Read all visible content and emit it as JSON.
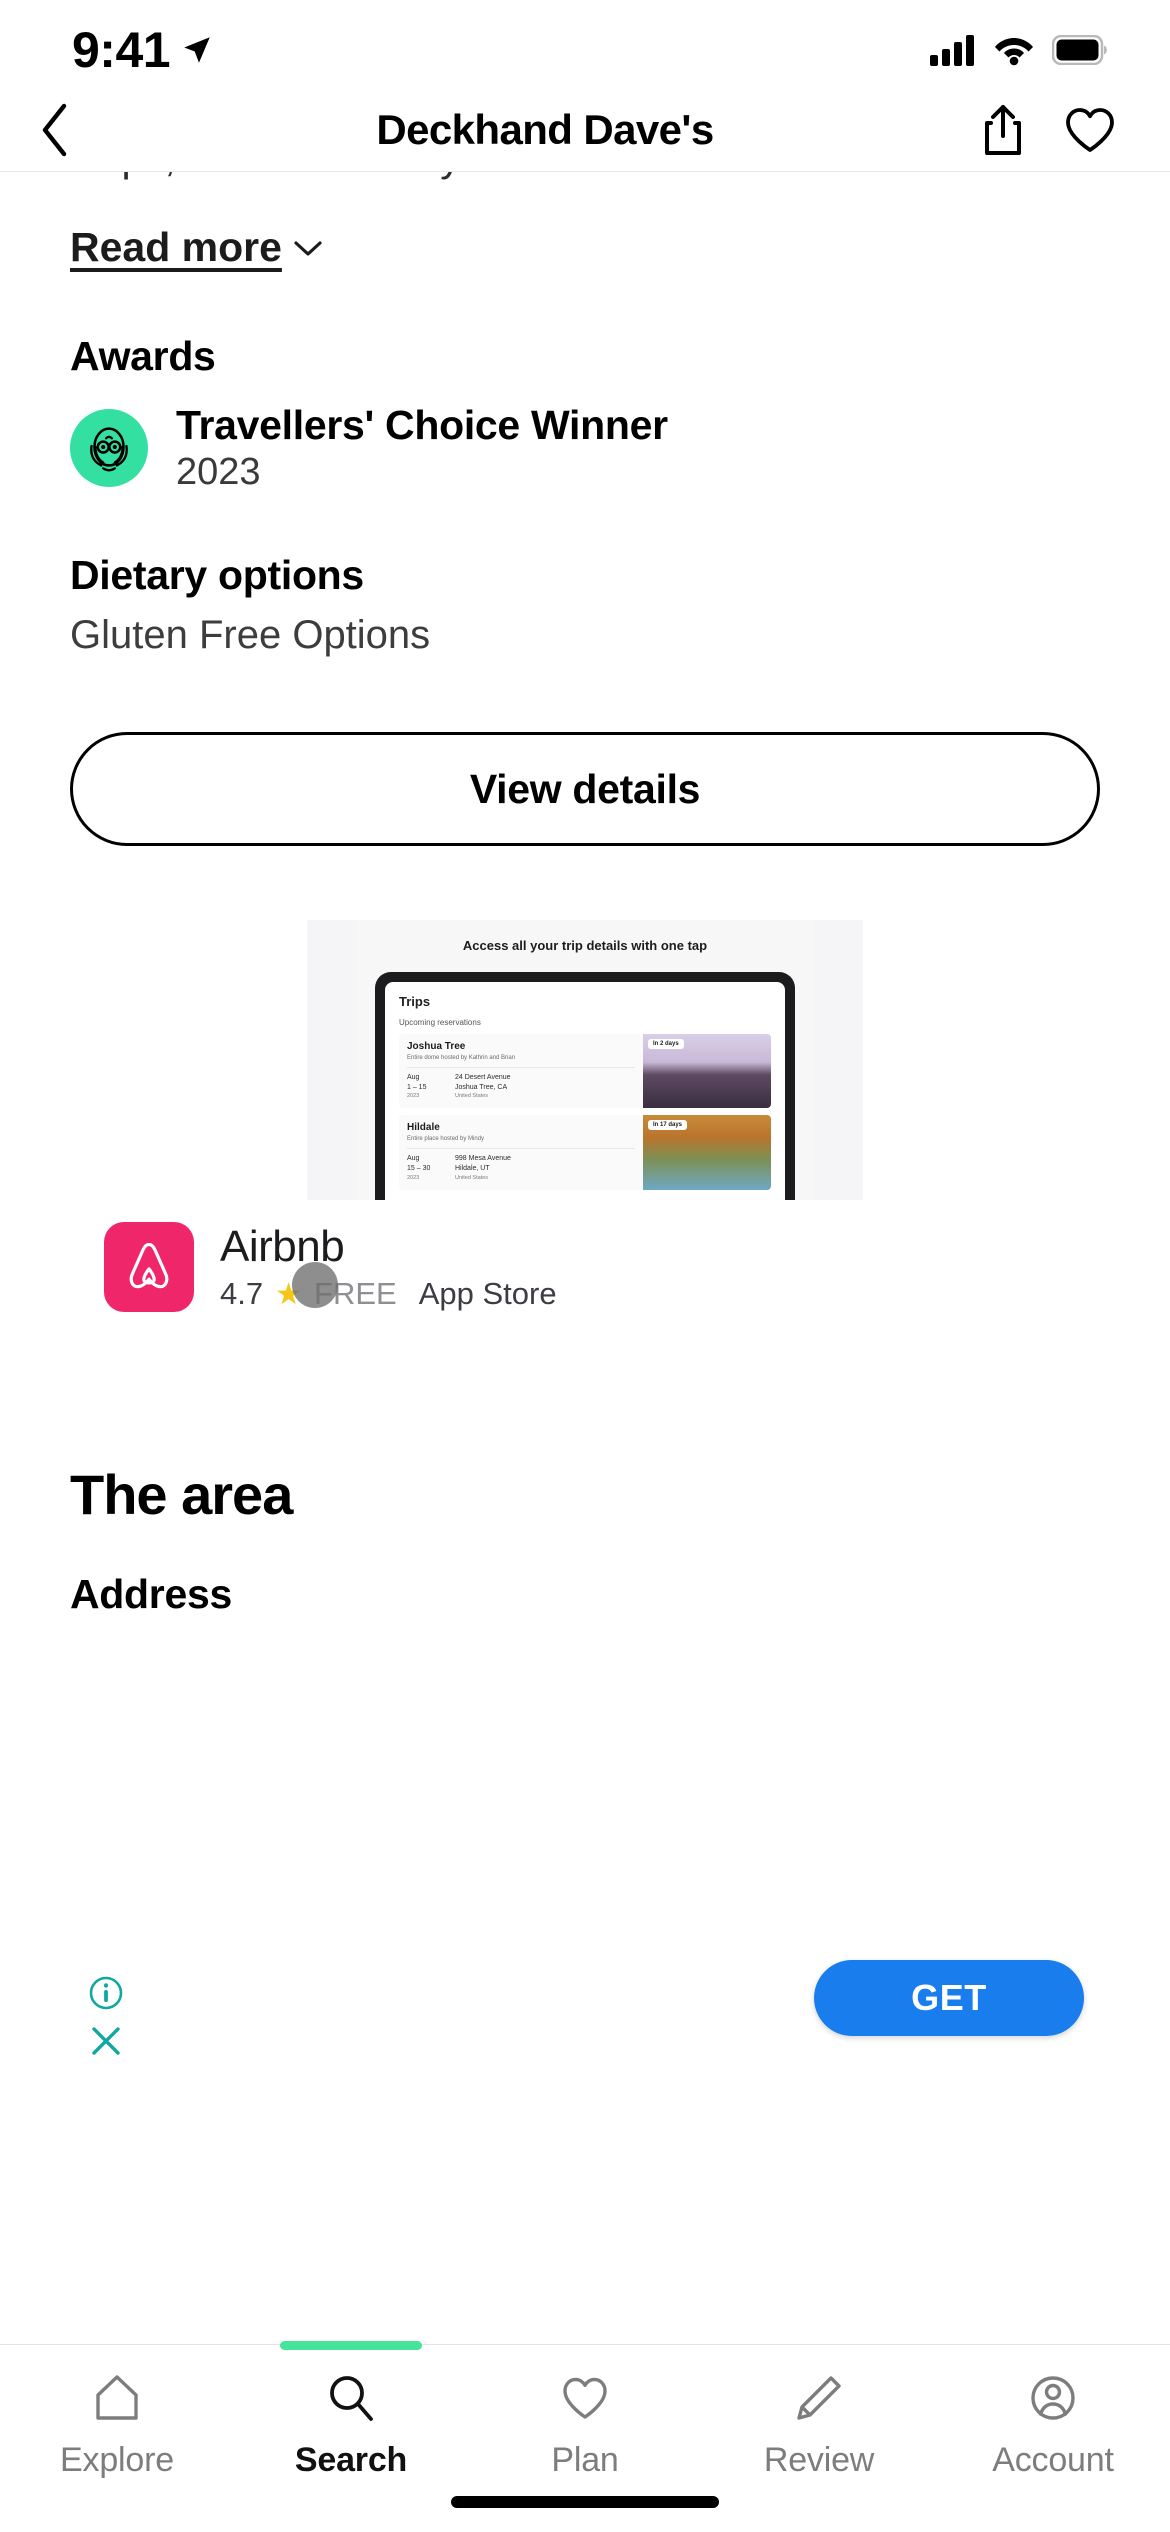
{
  "status_bar": {
    "time": "9:41",
    "location_icon": "location-arrow-icon",
    "cellular_icon": "cellular-bars-icon",
    "wifi_icon": "wifi-icon",
    "battery_icon": "battery-full-icon"
  },
  "header": {
    "back_icon": "chevron-left-icon",
    "title": "Deckhand Dave's",
    "share_icon": "share-icon",
    "save_icon": "heart-outline-icon"
  },
  "description": {
    "truncated_text": "chips,FRESH local oysters beer and wine. Lo...",
    "read_more_label": "Read more",
    "chevron_icon": "chevron-down-icon"
  },
  "awards": {
    "heading": "Awards",
    "badge_icon": "tripadvisor-owl-icon",
    "badge_color": "#34E0A1",
    "name": "Travellers' Choice Winner",
    "year": "2023"
  },
  "dietary": {
    "heading": "Dietary options",
    "value": "Gluten Free Options"
  },
  "view_details_label": "View details",
  "ad": {
    "headline": "Access all your trip details with one tap",
    "tablet": {
      "screen_title": "Trips",
      "section_label": "Upcoming reservations",
      "reservations": [
        {
          "name": "Joshua Tree",
          "host": "Entire dome hosted by Kathrin and Brian",
          "month": "Aug",
          "days": "1 – 15",
          "year": "2023",
          "street": "24 Desert Avenue",
          "city": "Joshua Tree, CA",
          "country": "United States",
          "badge": "In 2 days"
        },
        {
          "name": "Hildale",
          "host": "Entire place hosted by Mindy",
          "month": "Aug",
          "days": "15 – 30",
          "year": "2023",
          "street": "998 Mesa Avenue",
          "city": "Hildale, UT",
          "country": "United States",
          "badge": "In 17 days"
        }
      ]
    },
    "app": {
      "icon_name": "airbnb-logo-icon",
      "icon_color": "#F0266B",
      "name": "Airbnb",
      "rating": "4.7",
      "star_icon": "star-icon",
      "price": "FREE",
      "source": "App Store"
    },
    "info_icon": "info-circle-icon",
    "close_icon": "close-x-icon",
    "controls_color": "#12A8A0",
    "cta_label": "GET",
    "cta_color": "#1A7DED"
  },
  "area": {
    "title": "The area",
    "subtitle": "Address"
  },
  "tabbar": {
    "active_color": "#45E39C",
    "items": [
      {
        "label": "Explore",
        "icon": "home-icon",
        "active": false
      },
      {
        "label": "Search",
        "icon": "search-icon",
        "active": true
      },
      {
        "label": "Plan",
        "icon": "heart-icon",
        "active": false
      },
      {
        "label": "Review",
        "icon": "pencil-icon",
        "active": false
      },
      {
        "label": "Account",
        "icon": "account-circle-icon",
        "active": false
      }
    ]
  }
}
